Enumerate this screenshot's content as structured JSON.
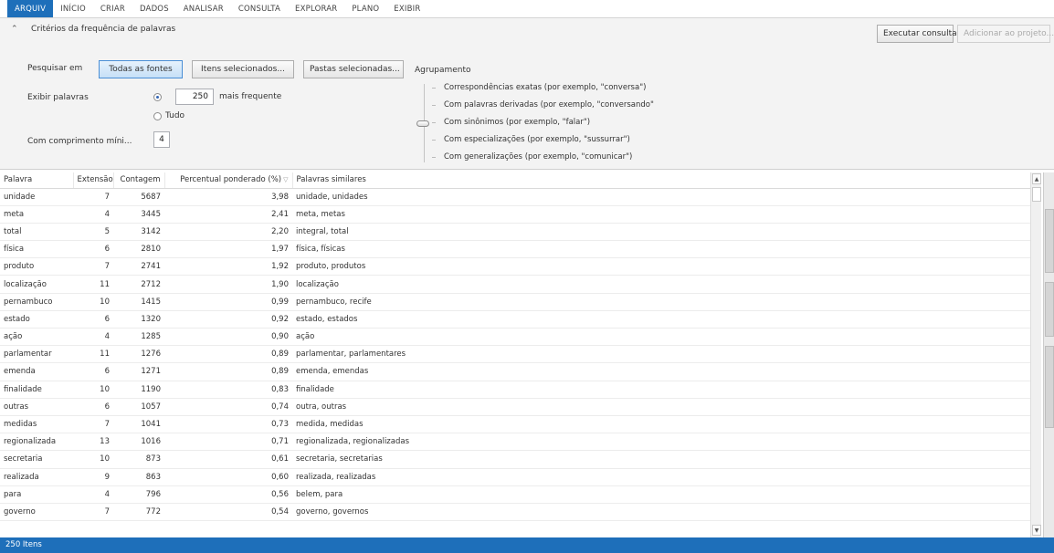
{
  "menu": [
    "ARQUIV",
    "INÍCIO",
    "CRIAR",
    "DADOS",
    "ANALISAR",
    "CONSULTA",
    "EXPLORAR",
    "PLANO",
    "EXIBIR"
  ],
  "criteria": {
    "title": "Critérios da frequência de palavras",
    "run_query": "Executar consulta",
    "add_to_project": "Adicionar ao projeto...",
    "search_in_label": "Pesquisar em",
    "all_sources": "Todas as fontes",
    "selected_items": "Itens selecionados...",
    "selected_folders": "Pastas selecionadas...",
    "show_words_label": "Exibir palavras",
    "word_count": "250",
    "most_frequent": "mais frequente",
    "all": "Tudo",
    "min_length_label": "Com comprimento míni...",
    "min_length": "4",
    "grouping_label": "Agrupamento",
    "grouping_options": [
      "Correspondências exatas (por exemplo, \"conversa\")",
      "Com palavras derivadas (por exemplo, \"conversando\"",
      "Com sinônimos (por exemplo, \"falar\")",
      "Com especializações (por exemplo, \"sussurrar\")",
      "Com generalizações (por exemplo, \"comunicar\")"
    ]
  },
  "table": {
    "headers": [
      "Palavra",
      "Extensão",
      "Contagem",
      "Percentual ponderado (%)",
      "Palavras similares"
    ],
    "rows": [
      [
        "unidade",
        "7",
        "5687",
        "3,98",
        "unidade, unidades"
      ],
      [
        "meta",
        "4",
        "3445",
        "2,41",
        "meta, metas"
      ],
      [
        "total",
        "5",
        "3142",
        "2,20",
        "integral, total"
      ],
      [
        "física",
        "6",
        "2810",
        "1,97",
        "física, físicas"
      ],
      [
        "produto",
        "7",
        "2741",
        "1,92",
        "produto, produtos"
      ],
      [
        "localização",
        "11",
        "2712",
        "1,90",
        "localização"
      ],
      [
        "pernambuco",
        "10",
        "1415",
        "0,99",
        "pernambuco, recife"
      ],
      [
        "estado",
        "6",
        "1320",
        "0,92",
        "estado, estados"
      ],
      [
        "ação",
        "4",
        "1285",
        "0,90",
        "ação"
      ],
      [
        "parlamentar",
        "11",
        "1276",
        "0,89",
        "parlamentar, parlamentares"
      ],
      [
        "emenda",
        "6",
        "1271",
        "0,89",
        "emenda, emendas"
      ],
      [
        "finalidade",
        "10",
        "1190",
        "0,83",
        "finalidade"
      ],
      [
        "outras",
        "6",
        "1057",
        "0,74",
        "outra, outras"
      ],
      [
        "medidas",
        "7",
        "1041",
        "0,73",
        "medida, medidas"
      ],
      [
        "regionalizada",
        "13",
        "1016",
        "0,71",
        "regionalizada, regionalizadas"
      ],
      [
        "secretaria",
        "10",
        "873",
        "0,61",
        "secretaria, secretarias"
      ],
      [
        "realizada",
        "9",
        "863",
        "0,60",
        "realizada, realizadas"
      ],
      [
        "para",
        "4",
        "796",
        "0,56",
        "belem, para"
      ],
      [
        "governo",
        "7",
        "772",
        "0,54",
        "governo, governos"
      ]
    ]
  },
  "status": "250 Itens",
  "colors": {
    "accent": "#1e6fba"
  }
}
